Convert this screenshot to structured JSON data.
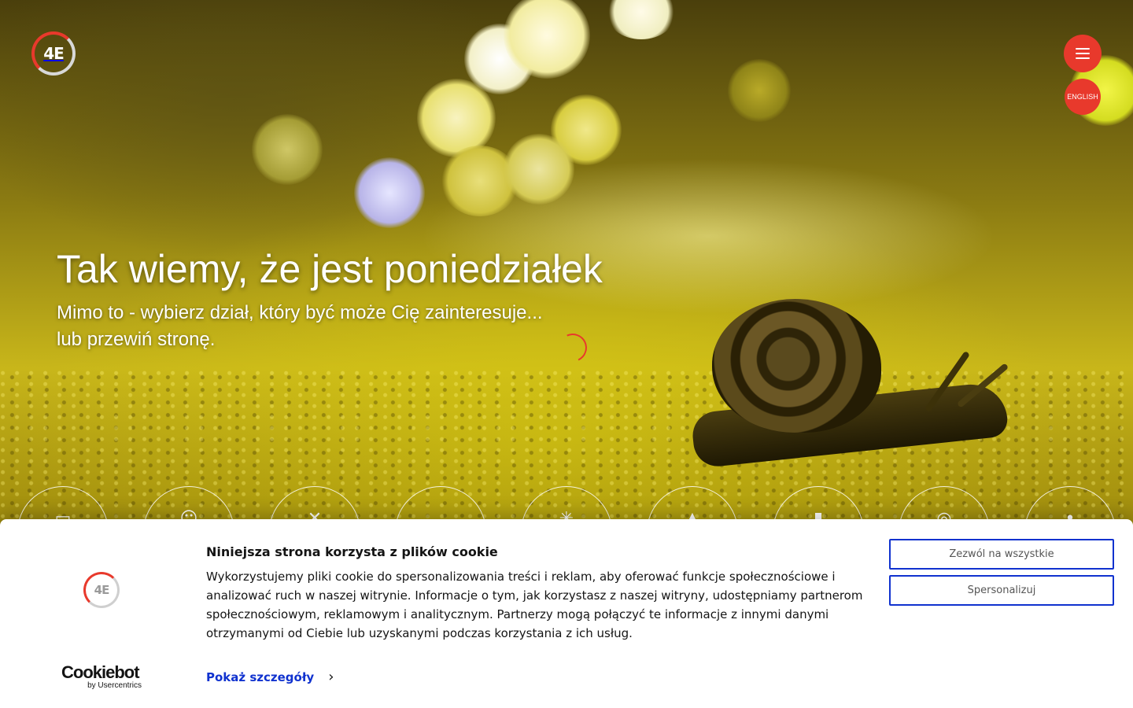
{
  "brand": {
    "logo_text": "4E",
    "logo_icon": "4e-logo-icon"
  },
  "nav": {
    "menu_icon": "hamburger-menu-icon",
    "language_label": "ENGLISH"
  },
  "hero": {
    "headline": "Tak wiemy, że jest poniedziałek",
    "subline_1": "Mimo to - wybierz dział, który być może Cię zainteresuje...",
    "subline_2": "lub przewiń stronę.",
    "loading_icon": "spinner-icon"
  },
  "categories": [
    {
      "icon": "document-icon",
      "glyph": "▭"
    },
    {
      "icon": "people-icon",
      "glyph": "☺"
    },
    {
      "icon": "tools-icon",
      "glyph": "✕"
    },
    {
      "icon": "chart-icon",
      "glyph": ""
    },
    {
      "icon": "lightbulb-icon",
      "glyph": "✳"
    },
    {
      "icon": "house-icon",
      "glyph": "▲"
    },
    {
      "icon": "thumb-icon",
      "glyph": "▮"
    },
    {
      "icon": "target-icon",
      "glyph": "◎"
    },
    {
      "icon": "pin-icon",
      "glyph": "•"
    }
  ],
  "cookie_banner": {
    "title": "Niniejsza strona korzysta z plików cookie",
    "text": "Wykorzystujemy pliki cookie do spersonalizowania treści i reklam, aby oferować funkcje społecznościowe i analizować ruch w naszej witrynie. Informacje o tym, jak korzystasz z naszej witryny, udostępniamy partnerom społecznościowym, reklamowym i analitycznym. Partnerzy mogą połączyć te informacje z innymi danymi otrzymanymi od Ciebie lub uzyskanymi podczas korzystania z ich usług.",
    "details_link": "Pokaż szczegóły",
    "allow_all_label": "Zezwól na wszystkie",
    "customize_label": "Spersonalizuj",
    "provider_name": "Cookiebot",
    "provider_sub": "by Usercentrics",
    "logo_text": "4E"
  },
  "colors": {
    "accent": "#e8392c",
    "link": "#1032cf"
  }
}
